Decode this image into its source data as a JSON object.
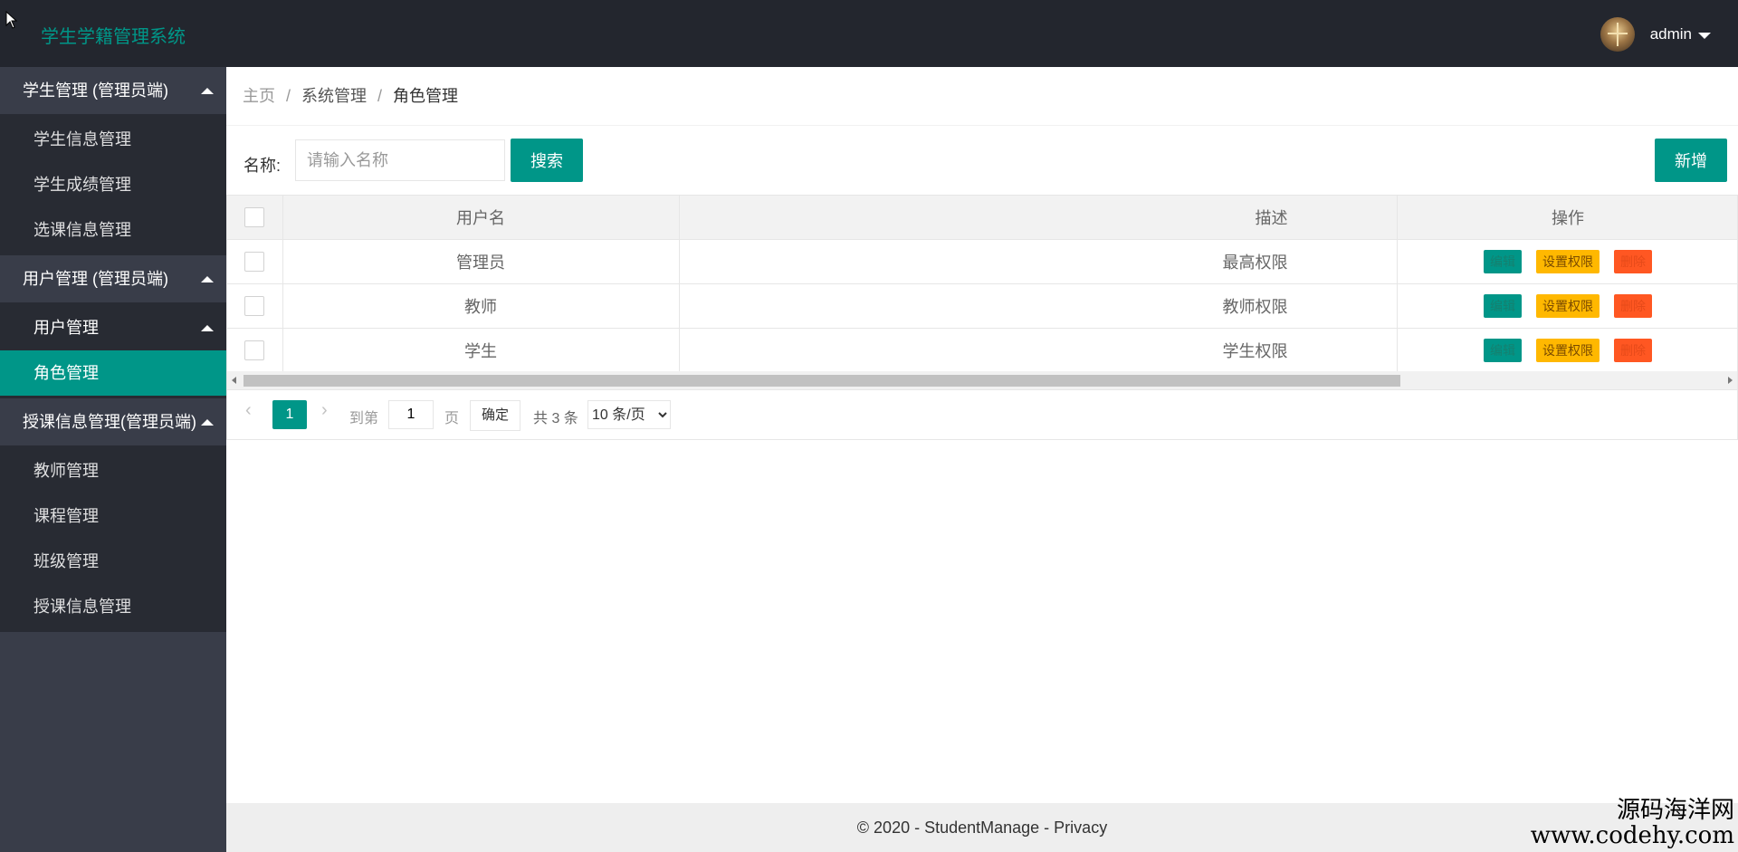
{
  "app": {
    "title": "学生学籍管理系统"
  },
  "user": {
    "name": "admin"
  },
  "sidebar": {
    "groups": [
      {
        "title": "学生管理 (管理员端)",
        "items": [
          {
            "label": "学生信息管理"
          },
          {
            "label": "学生成绩管理"
          },
          {
            "label": "选课信息管理"
          }
        ]
      },
      {
        "title": "用户管理 (管理员端)",
        "items": [
          {
            "label": "用户管理"
          },
          {
            "label": "角色管理"
          }
        ]
      },
      {
        "title": "授课信息管理(管理员端)",
        "items": [
          {
            "label": "教师管理"
          },
          {
            "label": "课程管理"
          },
          {
            "label": "班级管理"
          },
          {
            "label": "授课信息管理"
          }
        ]
      }
    ]
  },
  "breadcrumb": {
    "home": "主页",
    "section": "系统管理",
    "current": "角色管理"
  },
  "toolbar": {
    "search_label": "名称:",
    "search_placeholder": "请输入名称",
    "search_button": "搜索",
    "add_button": "新增"
  },
  "table": {
    "headers": {
      "username": "用户名",
      "description": "描述",
      "actions": "操作"
    },
    "rows": [
      {
        "username": "管理员",
        "description": "最高权限"
      },
      {
        "username": "教师",
        "description": "教师权限"
      },
      {
        "username": "学生",
        "description": "学生权限"
      }
    ],
    "actions": {
      "edit": "编辑",
      "permission": "设置权限",
      "delete": "删除"
    }
  },
  "pager": {
    "current_page": "1",
    "goto_label": "到第",
    "goto_value": "1",
    "page_label": "页",
    "confirm": "确定",
    "total": "共 3 条",
    "page_size": "10 条/页"
  },
  "footer": {
    "text": "© 2020 - StudentManage - Privacy"
  },
  "watermark": {
    "line1": "源码海洋网",
    "line2": "www.codehy.com"
  },
  "colors": {
    "accent": "#009688",
    "warn": "#ffb800",
    "danger": "#ff5722",
    "header_bg": "#23262e",
    "sidebar_bg": "#393d49"
  }
}
